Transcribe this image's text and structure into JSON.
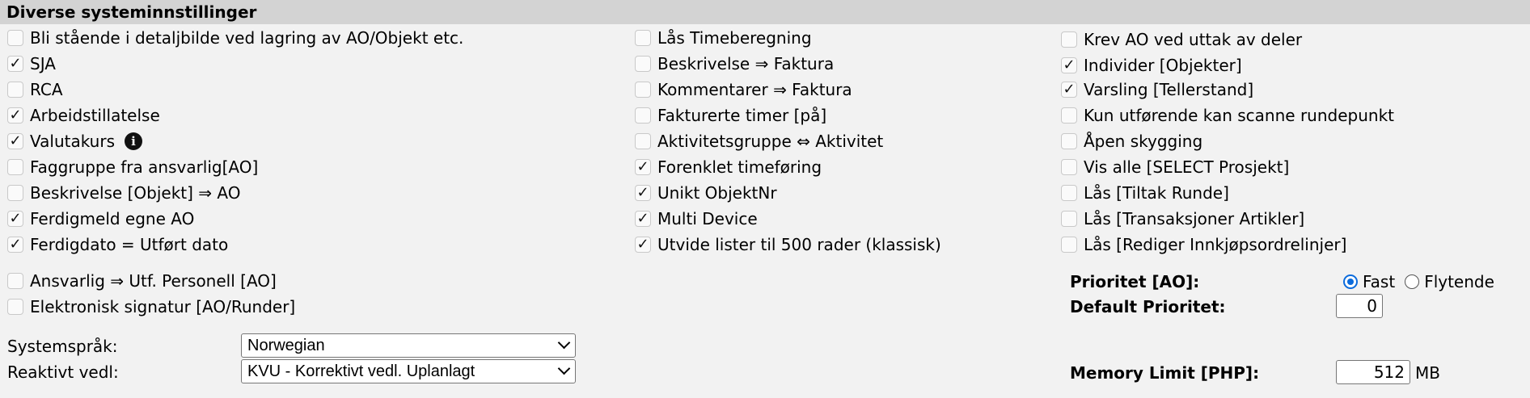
{
  "header": {
    "title": "Diverse systeminnstillinger"
  },
  "col1": [
    {
      "label": "Bli stående i detaljbilde ved lagring av AO/Objekt etc.",
      "checked": false
    },
    {
      "label": "SJA",
      "checked": true
    },
    {
      "label": "RCA",
      "checked": false
    },
    {
      "label": "Arbeidstillatelse",
      "checked": true
    },
    {
      "label": "Valutakurs",
      "checked": true
    },
    {
      "label": "Faggruppe fra ansvarlig[AO]",
      "checked": false
    },
    {
      "label": "Beskrivelse [Objekt] ⇒ AO",
      "checked": false
    },
    {
      "label": "Ferdigmeld egne AO",
      "checked": true
    },
    {
      "label": "Ferdigdato = Utført dato",
      "checked": true
    }
  ],
  "col2": [
    {
      "label": "Lås Timeberegning",
      "checked": false
    },
    {
      "label": "Beskrivelse ⇒ Faktura",
      "checked": false
    },
    {
      "label": "Kommentarer ⇒ Faktura",
      "checked": false
    },
    {
      "label": "Fakturerte timer [på]",
      "checked": false
    },
    {
      "label": "Aktivitetsgruppe ⇔ Aktivitet",
      "checked": false
    },
    {
      "label": "Forenklet timeføring",
      "checked": true
    },
    {
      "label": "Unikt ObjektNr",
      "checked": true
    },
    {
      "label": "Multi Device",
      "checked": true
    },
    {
      "label": "Utvide lister til 500 rader (klassisk)",
      "checked": true
    }
  ],
  "col3": [
    {
      "label": "Krev AO ved uttak av deler",
      "checked": false
    },
    {
      "label": "Individer [Objekter]",
      "checked": true
    },
    {
      "label": "Varsling [Tellerstand]",
      "checked": true
    },
    {
      "label": "Kun utførende kan scanne rundepunkt",
      "checked": false
    },
    {
      "label": "Åpen skygging",
      "checked": false
    },
    {
      "label": "Vis alle [SELECT Prosjekt]",
      "checked": false
    },
    {
      "label": "Lås [Tiltak Runde]",
      "checked": false
    },
    {
      "label": "Lås [Transaksjoner Artikler]",
      "checked": false
    },
    {
      "label": "Lås [Rediger Innkjøpsordrelinjer]",
      "checked": false
    }
  ],
  "lower": [
    {
      "label": "Ansvarlig ⇒ Utf. Personell [AO]",
      "checked": false
    },
    {
      "label": "Elektronisk signatur [AO/Runder]",
      "checked": false
    }
  ],
  "prioritet": {
    "label": "Prioritet [AO]:",
    "options": [
      "Fast",
      "Flytende"
    ],
    "selected": "Fast"
  },
  "default_prioritet": {
    "label": "Default Prioritet:",
    "value": "0"
  },
  "systemsprak": {
    "label": "Systemspråk:",
    "value": "Norwegian"
  },
  "reaktivt": {
    "label": "Reaktivt vedl:",
    "value": "KVU - Korrektivt vedl. Uplanlagt"
  },
  "memory": {
    "label": "Memory Limit [PHP]:",
    "value": "512",
    "unit": "MB"
  }
}
